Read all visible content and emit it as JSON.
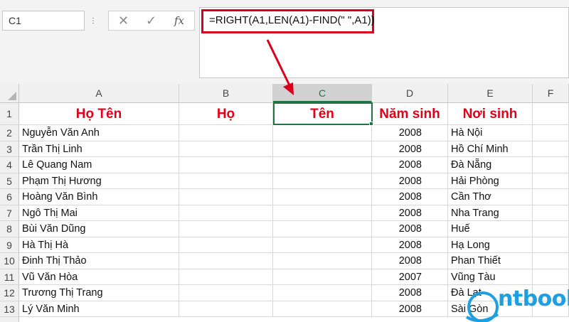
{
  "formula_bar": {
    "name_box": "C1",
    "cancel_glyph": "✕",
    "enter_glyph": "✓",
    "fx_glyph": "fx",
    "formula": "=RIGHT(A1,LEN(A1)-FIND(\" \",A1))"
  },
  "columns": [
    "A",
    "B",
    "C",
    "D",
    "E",
    "F"
  ],
  "selected_column": "C",
  "header_row": {
    "row": "1",
    "a": "Họ Tên",
    "b": "Họ",
    "c": "Tên",
    "d": "Năm sinh",
    "e": "Nơi sinh"
  },
  "rows": [
    {
      "row": "2",
      "name": "Nguyễn Văn Anh",
      "year": "2008",
      "place": "Hà Nội"
    },
    {
      "row": "3",
      "name": "Trần Thị Linh",
      "year": "2008",
      "place": "Hồ Chí Minh"
    },
    {
      "row": "4",
      "name": "Lê Quang Nam",
      "year": "2008",
      "place": "Đà Nẵng"
    },
    {
      "row": "5",
      "name": "Phạm Thị Hương",
      "year": "2008",
      "place": "Hải Phòng"
    },
    {
      "row": "6",
      "name": "Hoàng Văn Bình",
      "year": "2008",
      "place": "Cần Thơ"
    },
    {
      "row": "7",
      "name": "Ngô Thị Mai",
      "year": "2008",
      "place": "Nha Trang"
    },
    {
      "row": "8",
      "name": "Bùi Văn Dũng",
      "year": "2008",
      "place": "Huế"
    },
    {
      "row": "9",
      "name": "Hà Thị Hà",
      "year": "2008",
      "place": "Hạ Long"
    },
    {
      "row": "10",
      "name": "Đinh Thị Thảo",
      "year": "2008",
      "place": "Phan Thiết"
    },
    {
      "row": "11",
      "name": "Vũ Văn Hòa",
      "year": "2007",
      "place": "Vũng Tàu"
    },
    {
      "row": "12",
      "name": "Trương Thị Trang",
      "year": "2008",
      "place": "Đà Lạt"
    },
    {
      "row": "13",
      "name": "Lý Văn Minh",
      "year": "2008",
      "place": "Sài Gòn"
    }
  ],
  "watermark": {
    "text": "ntbook"
  },
  "colors": {
    "header_red": "#e0001b",
    "excel_green": "#217346",
    "annotation_red": "#d9001b",
    "watermark_blue": "#1d9fe0"
  }
}
